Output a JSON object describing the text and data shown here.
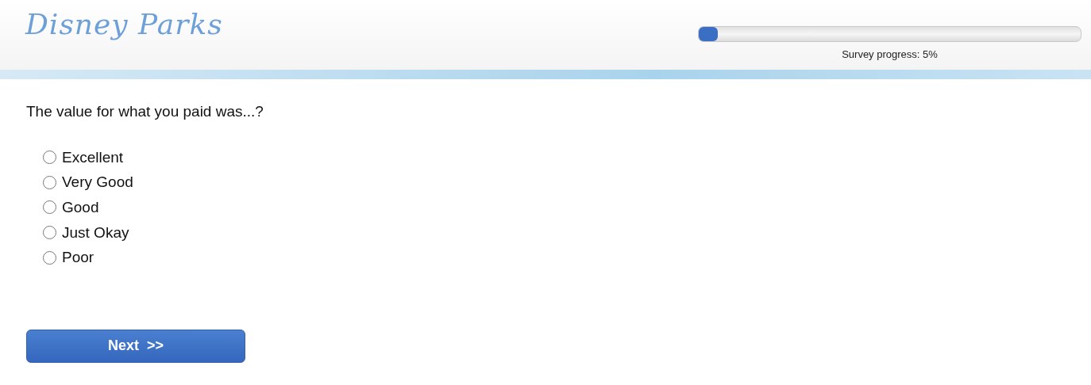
{
  "header": {
    "logo": "Disney Parks"
  },
  "progress": {
    "level": 0.05,
    "label": "Survey progress: 5%"
  },
  "question": "The value for what you paid was...?",
  "options": [
    {
      "label": "Excellent",
      "selected": false
    },
    {
      "label": "Very Good",
      "selected": false
    },
    {
      "label": "Good",
      "selected": false
    },
    {
      "label": "Just Okay",
      "selected": false
    },
    {
      "label": "Poor",
      "selected": false
    }
  ],
  "next_button": "Next  >>"
}
